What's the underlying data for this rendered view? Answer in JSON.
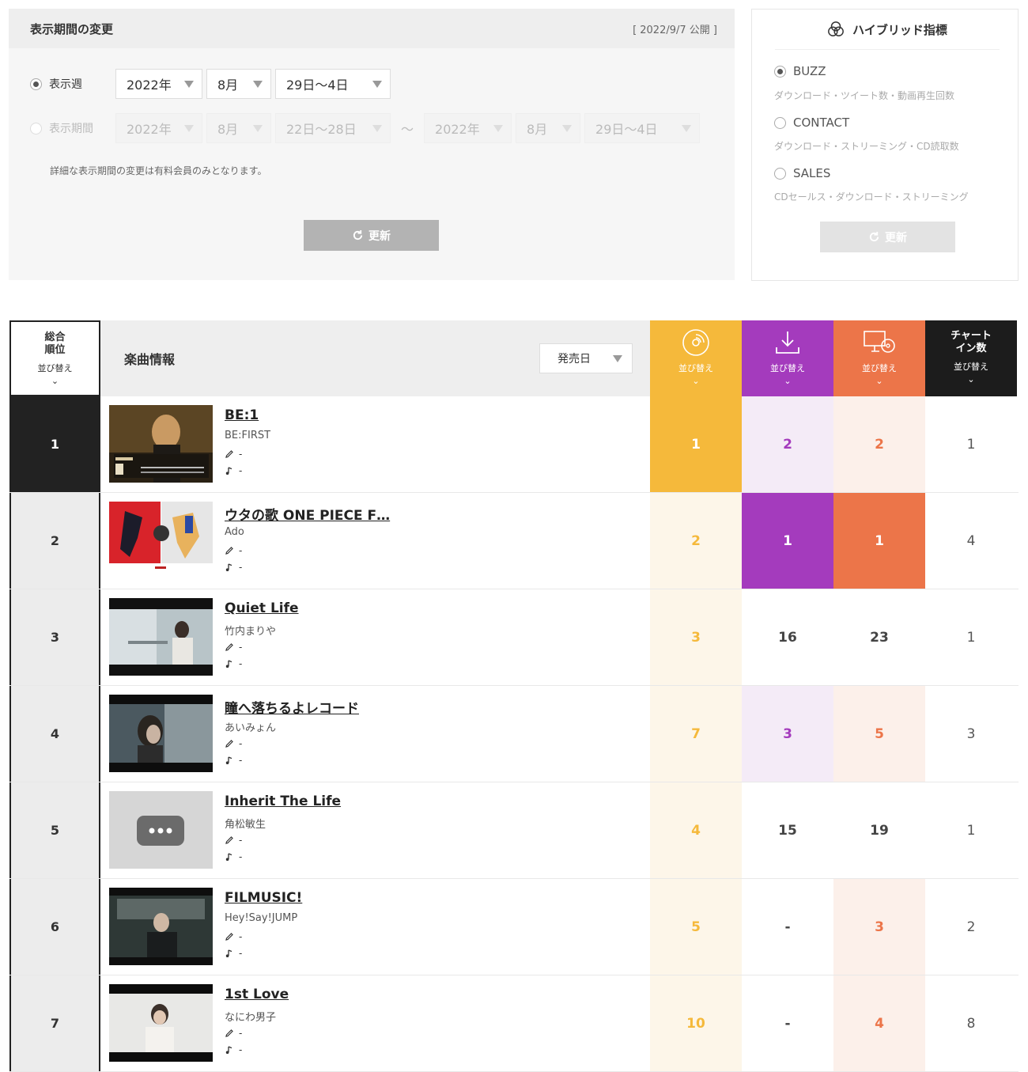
{
  "period": {
    "title": "表示期間の変更",
    "published": "[ 2022/9/7 公開 ]",
    "week_label": "表示週",
    "range_label": "表示期間",
    "week": {
      "year": "2022年",
      "month": "8月",
      "days": "29日〜4日"
    },
    "range_from": {
      "year": "2022年",
      "month": "8月",
      "days": "22日〜28日"
    },
    "range_sep": "〜",
    "range_to": {
      "year": "2022年",
      "month": "8月",
      "days": "29日〜4日"
    },
    "note": "詳細な表示期間の変更は有料会員のみとなります。",
    "update_label": "更新"
  },
  "hybrid": {
    "title": "ハイブリッド指標",
    "options": [
      {
        "label": "BUZZ",
        "desc": "ダウンロード・ツイート数・動画再生回数",
        "selected": true
      },
      {
        "label": "CONTACT",
        "desc": "ダウンロード・ストリーミング・CD読取数",
        "selected": false
      },
      {
        "label": "SALES",
        "desc": "CDセールス・ダウンロード・ストリーミング",
        "selected": false
      }
    ],
    "update_label": "更新"
  },
  "table": {
    "rank_header": "総合\n順位",
    "sort_label": "並び替え",
    "info_header": "楽曲情報",
    "sort_select": "発売日",
    "chart_in_header": "チャート\nイン数",
    "colors": {
      "streaming": "#f5b93b",
      "download": "#a43bbd",
      "video": "#ec7549",
      "chart": "#1c1c1c"
    },
    "rows": [
      {
        "rank": "1",
        "title": "BE:1",
        "artist": "BE:FIRST",
        "lyric": "-",
        "music": "-",
        "streaming": "1",
        "download": "2",
        "video": "2",
        "chart_in": "1",
        "thumb": "befirst"
      },
      {
        "rank": "2",
        "title": "ウタの歌 ONE PIECE F…",
        "artist": "Ado",
        "lyric": "-",
        "music": "-",
        "streaming": "2",
        "download": "1",
        "video": "1",
        "chart_in": "4",
        "thumb": "ado"
      },
      {
        "rank": "3",
        "title": "Quiet Life",
        "artist": "竹内まりや",
        "lyric": "-",
        "music": "-",
        "streaming": "3",
        "download": "16",
        "video": "23",
        "chart_in": "1",
        "thumb": "quiet"
      },
      {
        "rank": "4",
        "title": "瞳へ落ちるよレコード",
        "artist": "あいみょん",
        "lyric": "-",
        "music": "-",
        "streaming": "7",
        "download": "3",
        "video": "5",
        "chart_in": "3",
        "thumb": "aimyon"
      },
      {
        "rank": "5",
        "title": "Inherit The Life",
        "artist": "角松敏生",
        "lyric": "-",
        "music": "-",
        "streaming": "4",
        "download": "15",
        "video": "19",
        "chart_in": "1",
        "thumb": "placeholder"
      },
      {
        "rank": "6",
        "title": "FILMUSIC!",
        "artist": "Hey!Say!JUMP",
        "lyric": "-",
        "music": "-",
        "streaming": "5",
        "download": "-",
        "video": "3",
        "chart_in": "2",
        "thumb": "jump"
      },
      {
        "rank": "7",
        "title": "1st Love",
        "artist": "なにわ男子",
        "lyric": "-",
        "music": "-",
        "streaming": "10",
        "download": "-",
        "video": "4",
        "chart_in": "8",
        "thumb": "naniwa"
      }
    ]
  }
}
